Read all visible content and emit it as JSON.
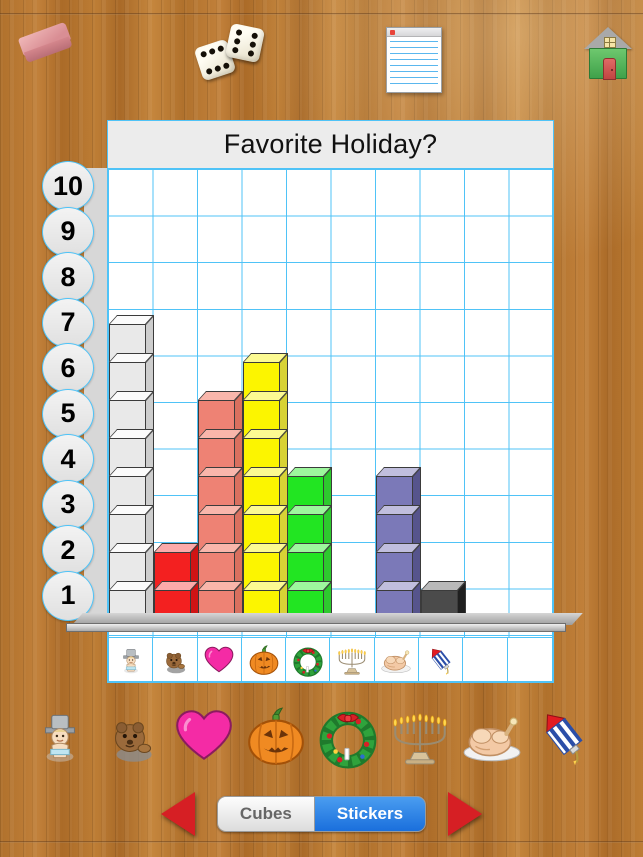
{
  "app": {
    "background": "wood-desk",
    "wood_color": "#b5762e"
  },
  "toolbar": {
    "items": [
      {
        "name": "eraser-icon",
        "label": "Eraser",
        "color": "#d98e94"
      },
      {
        "name": "dice-icon",
        "label": "Dice",
        "color": "#fffdf3"
      },
      {
        "name": "table-icon",
        "label": "Table",
        "color": "#ffffff"
      },
      {
        "name": "home-icon",
        "label": "Home",
        "color": "#4fae51"
      }
    ]
  },
  "chart": {
    "title": "Favorite Holiday?",
    "grid_columns": 10,
    "grid_rows": 10,
    "grid_color": "#4fc3f7",
    "title_background": "#ececec",
    "y_axis_labels": [
      "10",
      "9",
      "8",
      "7",
      "6",
      "5",
      "4",
      "3",
      "2",
      "1"
    ]
  },
  "chart_data": {
    "type": "bar",
    "title": "Favorite Holiday?",
    "xlabel": "",
    "ylabel": "",
    "ylim": [
      0,
      10
    ],
    "grid": true,
    "legend": "none",
    "categories": [
      "New Year",
      "Groundhog Day",
      "Valentine's Day",
      "Halloween",
      "Christmas",
      "Hanukkah",
      "Thanksgiving",
      "Fourth of July",
      "",
      ""
    ],
    "values": [
      8,
      2,
      6,
      7,
      4,
      0,
      4,
      1,
      0,
      0
    ],
    "bar_colors": [
      "#e9e9e9",
      "#f32020",
      "#ee8274",
      "#fcf500",
      "#22e522",
      "none",
      "#7b79b8",
      "#3a3a3a",
      "none",
      "none"
    ]
  },
  "bars": [
    {
      "name": "bar-new-year",
      "count": 8,
      "front": "#e9e9e9",
      "top": "#fbfbfb",
      "side": "#cdcdcd"
    },
    {
      "name": "bar-groundhog",
      "count": 2,
      "front": "#f32020",
      "top": "#fcaaaa",
      "side": "#d01414"
    },
    {
      "name": "bar-valentines",
      "count": 6,
      "front": "#ee8274",
      "top": "#f9b6ab",
      "side": "#d9705f"
    },
    {
      "name": "bar-halloween",
      "count": 7,
      "front": "#fcf500",
      "top": "#fcfa92",
      "side": "#d8d235"
    },
    {
      "name": "bar-christmas",
      "count": 4,
      "front": "#22e522",
      "top": "#9df79d",
      "side": "#2ec92e"
    },
    {
      "name": "bar-hanukkah",
      "count": 0,
      "front": "none",
      "top": "none",
      "side": "none"
    },
    {
      "name": "bar-thanksgiving",
      "count": 4,
      "front": "#7b79b8",
      "top": "#c0bedd",
      "side": "#56548c"
    },
    {
      "name": "bar-fourth-july",
      "count": 1,
      "front": "#4b4b4b",
      "top": "#b9b9b9",
      "side": "#1f1f1f"
    },
    {
      "name": "bar-empty-9",
      "count": 0,
      "front": "none",
      "top": "none",
      "side": "none"
    },
    {
      "name": "bar-empty-10",
      "count": 0,
      "front": "none",
      "top": "none",
      "side": "none"
    }
  ],
  "category_stickers": [
    {
      "name": "sticker-new-year-baby",
      "label": "New Year Baby"
    },
    {
      "name": "sticker-groundhog",
      "label": "Groundhog"
    },
    {
      "name": "sticker-heart",
      "label": "Heart"
    },
    {
      "name": "sticker-pumpkin",
      "label": "Jack-o-lantern"
    },
    {
      "name": "sticker-wreath",
      "label": "Christmas Wreath"
    },
    {
      "name": "sticker-menorah",
      "label": "Menorah"
    },
    {
      "name": "sticker-turkey",
      "label": "Turkey"
    },
    {
      "name": "sticker-firework",
      "label": "Firework"
    },
    {
      "name": "sticker-empty-9",
      "label": ""
    },
    {
      "name": "sticker-empty-10",
      "label": ""
    }
  ],
  "palette": {
    "items": [
      {
        "name": "palette-new-year-baby",
        "label": "New Year Baby"
      },
      {
        "name": "palette-groundhog",
        "label": "Groundhog"
      },
      {
        "name": "palette-heart",
        "label": "Heart"
      },
      {
        "name": "palette-pumpkin",
        "label": "Jack-o-lantern"
      },
      {
        "name": "palette-wreath",
        "label": "Christmas Wreath"
      },
      {
        "name": "palette-menorah",
        "label": "Menorah"
      },
      {
        "name": "palette-turkey",
        "label": "Turkey"
      },
      {
        "name": "palette-firework",
        "label": "Firework"
      }
    ]
  },
  "controls": {
    "prev_label": "Previous",
    "next_label": "Next",
    "mode_cubes": "Cubes",
    "mode_stickers": "Stickers",
    "active_mode": "Stickers",
    "active_color": "#1a6fdc"
  }
}
